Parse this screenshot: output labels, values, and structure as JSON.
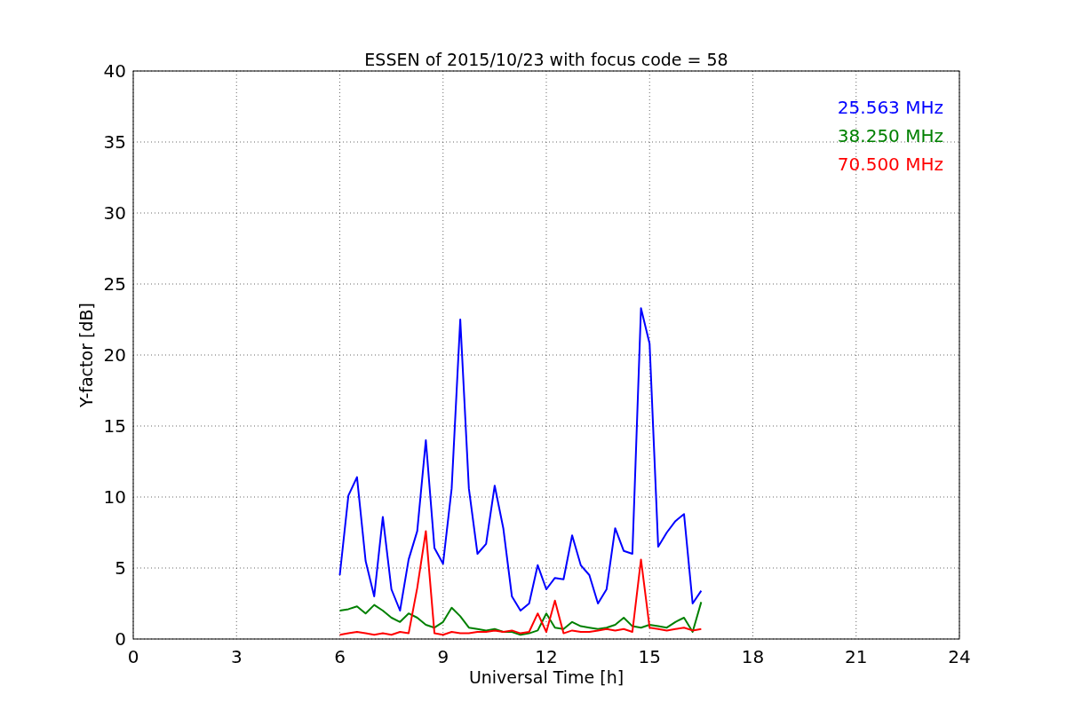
{
  "figure": {
    "chart_data": {
      "type": "line",
      "title": "ESSEN of 2015/10/23 with focus code = 58",
      "xlabel": "Universal Time [h]",
      "ylabel": "Y-factor [dB]",
      "xlim": [
        0,
        24
      ],
      "ylim": [
        0,
        40
      ],
      "grid": true,
      "xticks": [
        0,
        3,
        6,
        9,
        12,
        15,
        18,
        21,
        24
      ],
      "yticks": [
        0,
        5,
        10,
        15,
        20,
        25,
        30,
        35,
        40
      ],
      "x": [
        6,
        6.25,
        6.5,
        6.75,
        7,
        7.25,
        7.5,
        7.75,
        8,
        8.25,
        8.5,
        8.75,
        9,
        9.25,
        9.5,
        9.75,
        10,
        10.25,
        10.5,
        10.75,
        11,
        11.25,
        11.5,
        11.75,
        12,
        12.25,
        12.5,
        12.75,
        13,
        13.25,
        13.5,
        13.75,
        14,
        14.25,
        14.5,
        14.75,
        15,
        15.25,
        15.5,
        15.75,
        16,
        16.25,
        16.5
      ],
      "series": [
        {
          "name": "25.563 MHz",
          "color": "#0000ff",
          "values": [
            4.5,
            10.1,
            11.4,
            5.5,
            3,
            8.6,
            3.5,
            2,
            5.6,
            7.6,
            14,
            6.4,
            5.3,
            10.6,
            22.5,
            10.6,
            6,
            6.7,
            10.8,
            7.8,
            3,
            2,
            2.5,
            5.2,
            3.5,
            4.3,
            4.2,
            7.3,
            5.2,
            4.5,
            2.5,
            3.5,
            7.8,
            6.2,
            6,
            23.3,
            20.8,
            6.5,
            7.5,
            8.3,
            8.8,
            2.5,
            3.4
          ]
        },
        {
          "name": "38.250 MHz",
          "color": "#008000",
          "values": [
            2,
            2.1,
            2.3,
            1.8,
            2.4,
            2,
            1.5,
            1.2,
            1.8,
            1.5,
            1,
            0.8,
            1.2,
            2.2,
            1.6,
            0.8,
            0.7,
            0.6,
            0.7,
            0.5,
            0.5,
            0.3,
            0.4,
            0.6,
            1.8,
            0.8,
            0.7,
            1.2,
            0.9,
            0.8,
            0.7,
            0.8,
            1,
            1.5,
            0.9,
            0.8,
            1,
            0.9,
            0.8,
            1.2,
            1.5,
            0.5,
            2.6
          ]
        },
        {
          "name": "70.500 MHz",
          "color": "#ff0000",
          "values": [
            0.3,
            0.4,
            0.5,
            0.4,
            0.3,
            0.4,
            0.3,
            0.5,
            0.4,
            3.6,
            7.6,
            0.4,
            0.3,
            0.5,
            0.4,
            0.4,
            0.5,
            0.5,
            0.6,
            0.5,
            0.6,
            0.4,
            0.5,
            1.8,
            0.5,
            2.7,
            0.4,
            0.6,
            0.5,
            0.5,
            0.6,
            0.7,
            0.6,
            0.7,
            0.5,
            5.6,
            0.8,
            0.7,
            0.6,
            0.7,
            0.8,
            0.6,
            0.7
          ]
        }
      ]
    }
  }
}
